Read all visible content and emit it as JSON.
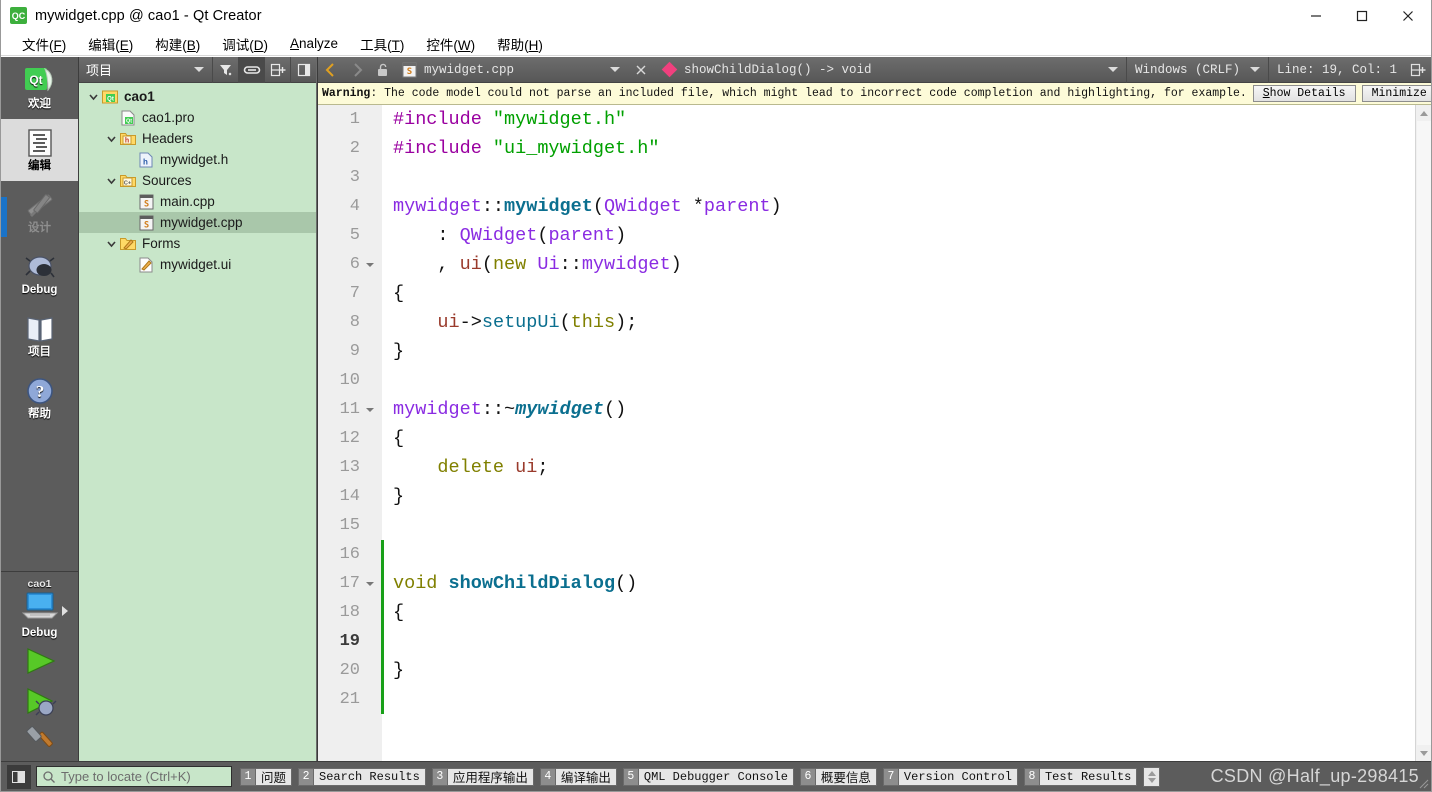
{
  "window": {
    "title": "mywidget.cpp @ cao1 - Qt Creator",
    "app_icon": "qt-creator-icon",
    "minimize_label": "minimize-icon",
    "maximize_label": "maximize-icon",
    "close_label": "close-icon"
  },
  "menubar": {
    "items": [
      {
        "text": "文件",
        "accel": "F"
      },
      {
        "text": "编辑",
        "accel": "E"
      },
      {
        "text": "构建",
        "accel": "B"
      },
      {
        "text": "调试",
        "accel": "D"
      },
      {
        "text": "Analyze",
        "accel": "A",
        "inline_accel": true
      },
      {
        "text": "工具",
        "accel": "T"
      },
      {
        "text": "控件",
        "accel": "W"
      },
      {
        "text": "帮助",
        "accel": "H"
      }
    ]
  },
  "modebar": {
    "modes": [
      {
        "label": "欢迎",
        "icon": "qt-welcome-icon",
        "state": "normal"
      },
      {
        "label": "编辑",
        "icon": "edit-document-icon",
        "state": "selected"
      },
      {
        "label": "设计",
        "icon": "design-ruler-pen-icon",
        "state": "disabled"
      },
      {
        "label": "Debug",
        "icon": "debug-bug-icon",
        "state": "normal"
      },
      {
        "label": "项目",
        "icon": "projects-book-icon",
        "state": "normal"
      },
      {
        "label": "帮助",
        "icon": "help-question-icon",
        "state": "normal"
      }
    ],
    "kit": {
      "project_name": "cao1",
      "build_config": "Debug",
      "icon": "target-monitor-icon",
      "arrow": "chevron-right-icon"
    },
    "actions": [
      {
        "name": "run",
        "icon": "run-play-icon"
      },
      {
        "name": "debug",
        "icon": "debug-play-bug-icon"
      },
      {
        "name": "build",
        "icon": "build-hammer-icon"
      }
    ]
  },
  "project_panel": {
    "selector_label": "项目",
    "toolbar_buttons": [
      {
        "name": "filter",
        "icon": "filter-funnel-icon"
      },
      {
        "name": "sync-with-editor",
        "icon": "link-chain-icon",
        "active": true
      },
      {
        "name": "expand-all",
        "icon": "split-add-icon"
      },
      {
        "name": "close-sidebar",
        "icon": "collapse-panel-icon"
      }
    ],
    "tree": [
      {
        "label": "cao1",
        "indent": 0,
        "twisty": "down",
        "icon": "qt-project-icon",
        "bold": true,
        "selected": false
      },
      {
        "label": "cao1.pro",
        "indent": 1,
        "twisty": "none",
        "icon": "qt-pro-file-icon",
        "bold": false,
        "selected": false
      },
      {
        "label": "Headers",
        "indent": 1,
        "twisty": "down",
        "icon": "folder-h-icon",
        "bold": false,
        "selected": false
      },
      {
        "label": "mywidget.h",
        "indent": 2,
        "twisty": "none",
        "icon": "header-file-icon",
        "bold": false,
        "selected": false
      },
      {
        "label": "Sources",
        "indent": 1,
        "twisty": "down",
        "icon": "folder-cpp-icon",
        "bold": false,
        "selected": false
      },
      {
        "label": "main.cpp",
        "indent": 2,
        "twisty": "none",
        "icon": "source-file-icon",
        "bold": false,
        "selected": false
      },
      {
        "label": "mywidget.cpp",
        "indent": 2,
        "twisty": "none",
        "icon": "source-file-icon",
        "bold": false,
        "selected": true
      },
      {
        "label": "Forms",
        "indent": 1,
        "twisty": "down",
        "icon": "folder-form-icon",
        "bold": false,
        "selected": false
      },
      {
        "label": "mywidget.ui",
        "indent": 2,
        "twisty": "none",
        "icon": "form-file-icon",
        "bold": false,
        "selected": false
      }
    ]
  },
  "editor_toolbar": {
    "back_icon": "chevron-left-icon",
    "forward_icon": "chevron-right-icon",
    "lock_icon": "unlocked-padlock-icon",
    "file_icon": "source-file-icon",
    "file_name": "mywidget.cpp",
    "close_icon": "close-x-icon",
    "symbol_icon": "pink-diamond-icon",
    "symbol_name": "showChildDialog() -> void",
    "line_ending": "Windows (CRLF)",
    "line_col": "Line: 19, Col: 1",
    "split_icon": "split-editor-icon"
  },
  "infobar": {
    "severity": "Warning",
    "message": ": The code model could not parse an included file, which might lead to incorrect code completion and highlighting, for example.",
    "show_details_label": "Show Details",
    "show_details_accel": "S",
    "minimize_label": "Minimize",
    "background": "#fdfbd8"
  },
  "code": {
    "current_line": 19,
    "total_lines": 21,
    "change_bar_color": "#18a018",
    "fold_lines": [
      6,
      11,
      17
    ],
    "lines": [
      {
        "n": 1,
        "tokens": [
          {
            "t": "#include ",
            "c": "pp"
          },
          {
            "t": "\"mywidget.h\"",
            "c": "str"
          }
        ]
      },
      {
        "n": 2,
        "tokens": [
          {
            "t": "#include ",
            "c": "pp"
          },
          {
            "t": "\"ui_mywidget.h\"",
            "c": "str"
          }
        ]
      },
      {
        "n": 3,
        "tokens": []
      },
      {
        "n": 4,
        "tokens": [
          {
            "t": "mywidget",
            "c": "cls"
          },
          {
            "t": "::",
            "c": "op"
          },
          {
            "t": "mywidget",
            "c": "fn"
          },
          {
            "t": "(",
            "c": "op"
          },
          {
            "t": "QWidget",
            "c": "typ"
          },
          {
            "t": " *",
            "c": "op"
          },
          {
            "t": "parent",
            "c": "typ"
          },
          {
            "t": ")",
            "c": "op"
          }
        ]
      },
      {
        "n": 5,
        "tokens": [
          {
            "t": "    : ",
            "c": "op"
          },
          {
            "t": "QWidget",
            "c": "typ"
          },
          {
            "t": "(",
            "c": "op"
          },
          {
            "t": "parent",
            "c": "typ"
          },
          {
            "t": ")",
            "c": "op"
          }
        ]
      },
      {
        "n": 6,
        "tokens": [
          {
            "t": "    , ",
            "c": "op"
          },
          {
            "t": "ui",
            "c": "mem"
          },
          {
            "t": "(",
            "c": "op"
          },
          {
            "t": "new",
            "c": "k"
          },
          {
            "t": " ",
            "c": "op"
          },
          {
            "t": "Ui",
            "c": "typ"
          },
          {
            "t": "::",
            "c": "op"
          },
          {
            "t": "mywidget",
            "c": "typ"
          },
          {
            "t": ")",
            "c": "op"
          }
        ]
      },
      {
        "n": 7,
        "tokens": [
          {
            "t": "{",
            "c": "op"
          }
        ]
      },
      {
        "n": 8,
        "tokens": [
          {
            "t": "    ",
            "c": "op"
          },
          {
            "t": "ui",
            "c": "mem"
          },
          {
            "t": "->",
            "c": "op"
          },
          {
            "t": "setupUi",
            "c": "tl"
          },
          {
            "t": "(",
            "c": "op"
          },
          {
            "t": "this",
            "c": "k"
          },
          {
            "t": ");",
            "c": "op"
          }
        ]
      },
      {
        "n": 9,
        "tokens": [
          {
            "t": "}",
            "c": "op"
          }
        ]
      },
      {
        "n": 10,
        "tokens": []
      },
      {
        "n": 11,
        "tokens": [
          {
            "t": "mywidget",
            "c": "cls"
          },
          {
            "t": "::~",
            "c": "op"
          },
          {
            "t": "mywidget",
            "c": "fni"
          },
          {
            "t": "()",
            "c": "op"
          }
        ]
      },
      {
        "n": 12,
        "tokens": [
          {
            "t": "{",
            "c": "op"
          }
        ]
      },
      {
        "n": 13,
        "tokens": [
          {
            "t": "    ",
            "c": "op"
          },
          {
            "t": "delete",
            "c": "k"
          },
          {
            "t": " ",
            "c": "op"
          },
          {
            "t": "ui",
            "c": "mem"
          },
          {
            "t": ";",
            "c": "op"
          }
        ]
      },
      {
        "n": 14,
        "tokens": [
          {
            "t": "}",
            "c": "op"
          }
        ]
      },
      {
        "n": 15,
        "tokens": []
      },
      {
        "n": 16,
        "tokens": []
      },
      {
        "n": 17,
        "tokens": [
          {
            "t": "void",
            "c": "k"
          },
          {
            "t": " ",
            "c": "op"
          },
          {
            "t": "showChildDialog",
            "c": "fn"
          },
          {
            "t": "()",
            "c": "op"
          }
        ]
      },
      {
        "n": 18,
        "tokens": [
          {
            "t": "{",
            "c": "op"
          }
        ]
      },
      {
        "n": 19,
        "tokens": []
      },
      {
        "n": 20,
        "tokens": [
          {
            "t": "}",
            "c": "op"
          }
        ]
      },
      {
        "n": 21,
        "tokens": []
      }
    ]
  },
  "bottombar": {
    "toggle_sidebar_icon": "toggle-output-pane-icon",
    "locator": {
      "icon": "search-icon",
      "placeholder": "Type to locate (Ctrl+K)",
      "value": ""
    },
    "output_tabs": [
      {
        "num": "1",
        "label": "问题",
        "cjk": true
      },
      {
        "num": "2",
        "label": "Search Results",
        "cjk": false
      },
      {
        "num": "3",
        "label": "应用程序输出",
        "cjk": true
      },
      {
        "num": "4",
        "label": "编译输出",
        "cjk": true
      },
      {
        "num": "5",
        "label": "QML Debugger Console",
        "cjk": false
      },
      {
        "num": "6",
        "label": "概要信息",
        "cjk": true
      },
      {
        "num": "7",
        "label": "Version Control",
        "cjk": false
      },
      {
        "num": "8",
        "label": "Test Results",
        "cjk": false
      }
    ],
    "spinner_icon": "updown-spinner-icon",
    "watermark": "CSDN @Half_up-298415",
    "resize_grip_icon": "resize-grip-icon"
  }
}
